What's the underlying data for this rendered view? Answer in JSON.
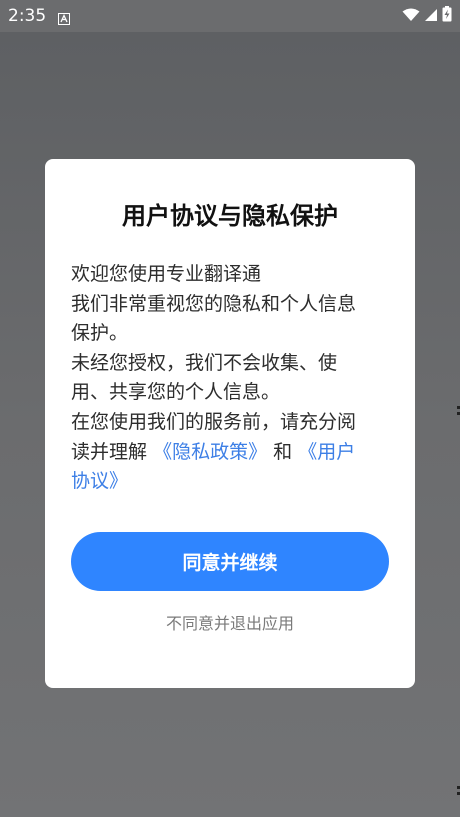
{
  "status_bar": {
    "time": "2:35",
    "icons": [
      "notification-a-icon",
      "wifi-icon",
      "signal-icon",
      "battery-charging-icon"
    ]
  },
  "dialog": {
    "title": "用户协议与隐私保护",
    "body": {
      "line1": "欢迎您使用专业翻译通",
      "line2": "我们非常重视您的隐私和个人信息",
      "line3": "保护。",
      "line4": "未经您授权，我们不会收集、使",
      "line5": "用、共享您的个人信息。",
      "line6": "在您使用我们的服务前，请充分阅",
      "line7_prefix": "读并理解",
      "privacy_link": "《隐私政策》",
      "and": "和",
      "user_agreement_link_part1": "《用户",
      "user_agreement_link_part2": "协议》"
    },
    "agree_button": "同意并继续",
    "decline_link": "不同意并退出应用"
  },
  "colors": {
    "primary": "#2f85ff",
    "link": "#3d7fe6",
    "scrim": "#6b6c6e"
  }
}
